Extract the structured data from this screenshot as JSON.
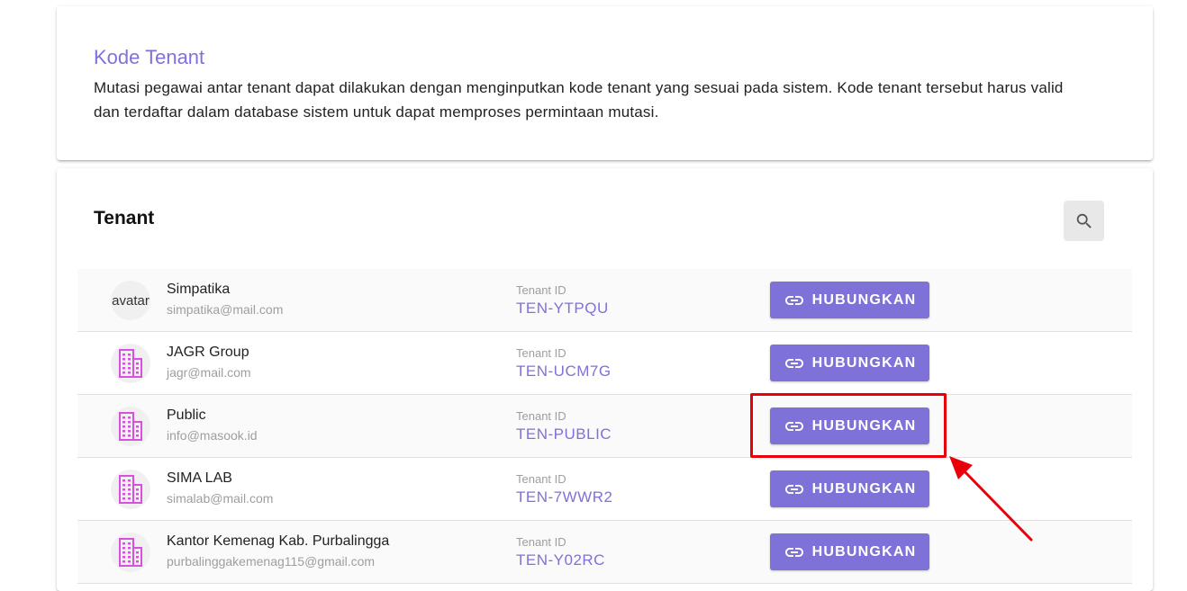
{
  "info": {
    "title": "Kode Tenant",
    "description": "Mutasi pegawai antar tenant dapat dilakukan dengan menginputkan kode tenant yang sesuai pada sistem. Kode tenant tersebut harus valid dan terdaftar dalam database sistem untuk dapat memproses permintaan mutasi."
  },
  "tenant_section": {
    "title": "Tenant",
    "search_icon": "search-icon",
    "tenant_id_label": "Tenant ID",
    "connect_label": "HUBUNGKAN",
    "connect_icon": "link-icon",
    "tenants": [
      {
        "name": "Simpatika",
        "email": "simpatika@mail.com",
        "tenant_id": "TEN-YTPQU",
        "avatar": "broken-image",
        "avatar_alt": "avatar"
      },
      {
        "name": "JAGR Group",
        "email": "jagr@mail.com",
        "tenant_id": "TEN-UCM7G",
        "avatar": "building-icon"
      },
      {
        "name": "Public",
        "email": "info@masook.id",
        "tenant_id": "TEN-PUBLIC",
        "avatar": "building-icon",
        "highlighted": true
      },
      {
        "name": "SIMA LAB",
        "email": "simalab@mail.com",
        "tenant_id": "TEN-7WWR2",
        "avatar": "building-icon"
      },
      {
        "name": "Kantor Kemenag Kab. Purbalingga",
        "email": "purbalinggakemenag115@gmail.com",
        "tenant_id": "TEN-Y02RC",
        "avatar": "building-icon"
      }
    ]
  },
  "colors": {
    "accent": "#7e72d8",
    "annotation": "#e8000b",
    "building_icon": "#d94fe0"
  }
}
